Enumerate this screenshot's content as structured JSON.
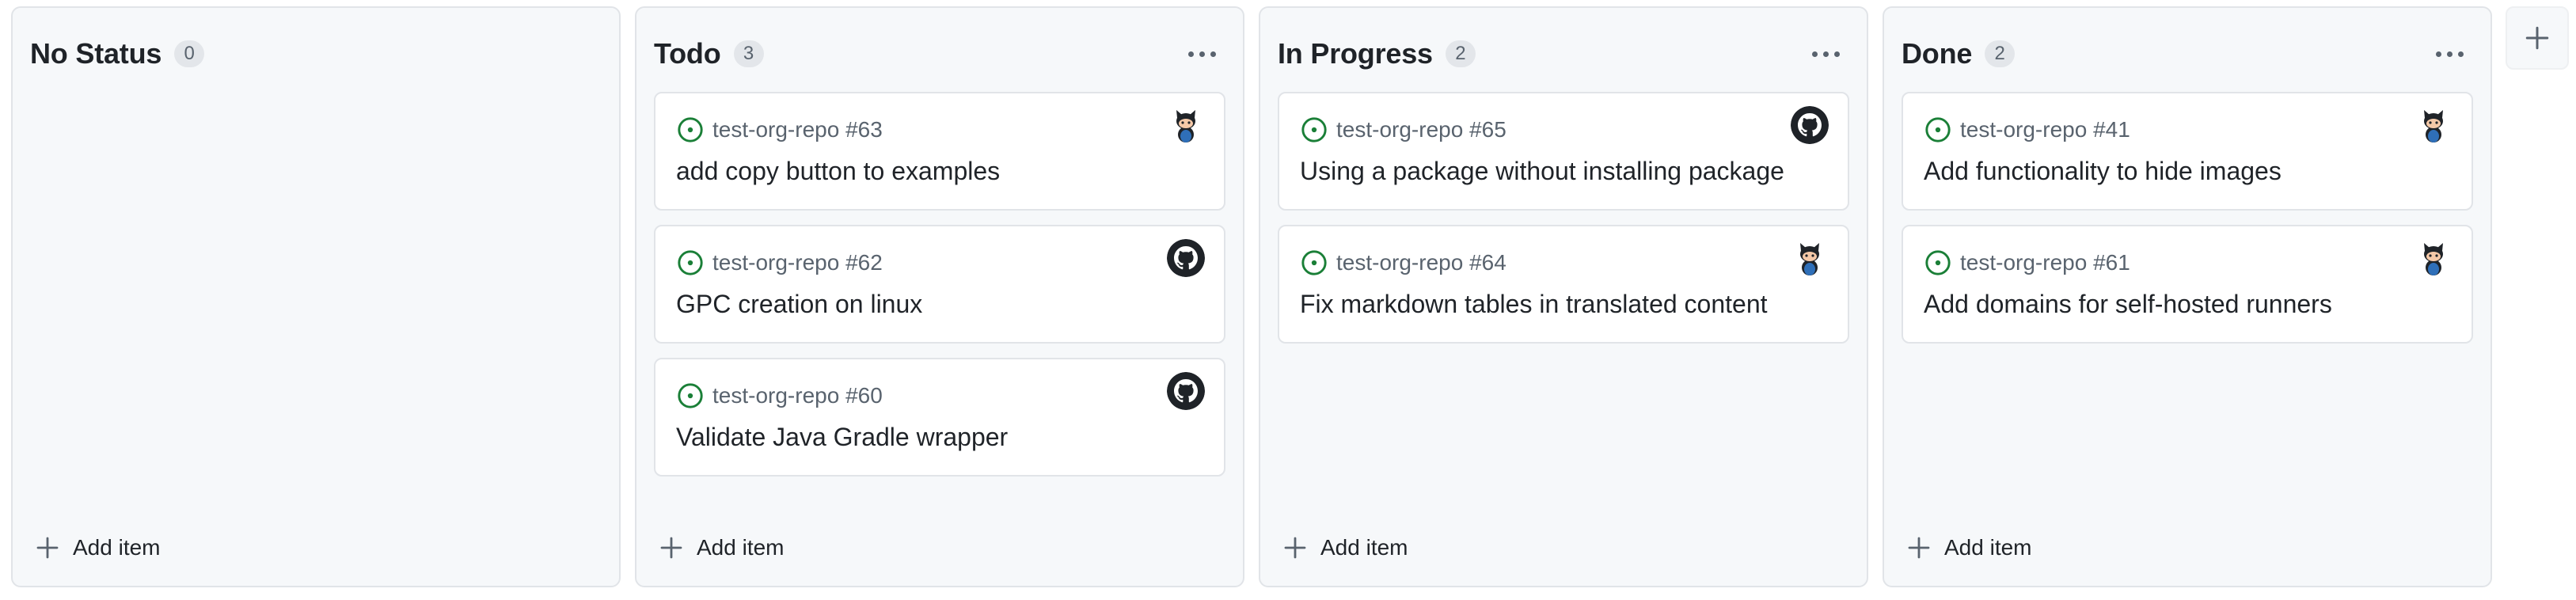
{
  "board": {
    "columns": [
      {
        "title": "No Status",
        "count": "0",
        "has_menu": false,
        "cards": [],
        "add_item_label": "Add item"
      },
      {
        "title": "Todo",
        "count": "3",
        "has_menu": true,
        "cards": [
          {
            "repo_ref": "test-org-repo #63",
            "title": "add copy button to examples",
            "avatar": "octocat-avatar"
          },
          {
            "repo_ref": "test-org-repo #62",
            "title": "GPC creation on linux",
            "avatar": "github-mark-avatar"
          },
          {
            "repo_ref": "test-org-repo #60",
            "title": "Validate Java Gradle wrapper",
            "avatar": "github-mark-avatar"
          }
        ],
        "add_item_label": "Add item"
      },
      {
        "title": "In Progress",
        "count": "2",
        "has_menu": true,
        "cards": [
          {
            "repo_ref": "test-org-repo #65",
            "title": "Using a package without installing package",
            "avatar": "github-mark-avatar"
          },
          {
            "repo_ref": "test-org-repo #64",
            "title": "Fix markdown tables in translated content",
            "avatar": "octocat-avatar"
          }
        ],
        "add_item_label": "Add item"
      },
      {
        "title": "Done",
        "count": "2",
        "has_menu": true,
        "cards": [
          {
            "repo_ref": "test-org-repo #41",
            "title": "Add functionality to hide images",
            "avatar": "octocat-avatar"
          },
          {
            "repo_ref": "test-org-repo #61",
            "title": "Add domains for self-hosted runners",
            "avatar": "octocat-avatar"
          }
        ],
        "add_item_label": "Add item"
      }
    ],
    "add_column_icon": "plus-icon"
  },
  "icons": {
    "issue_state": "issue-opened-icon",
    "menu": "kebab-horizontal-icon",
    "add": "plus-icon"
  },
  "colors": {
    "issue_open": "#1a7f37",
    "column_bg": "#f6f8fa",
    "border": "#e1e4e8",
    "muted_text": "#59636e"
  }
}
